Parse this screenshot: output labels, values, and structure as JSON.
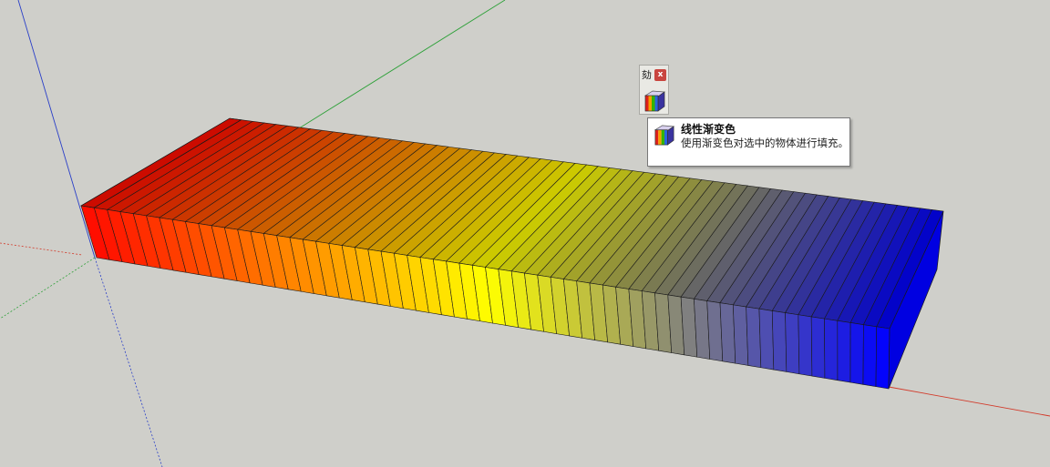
{
  "toolbar": {
    "title_glyph": "劾",
    "close_label": "x",
    "tool_icon": "gradient-cube-icon"
  },
  "tooltip": {
    "title": "线性渐变色",
    "description": "使用渐变色对选中的物体进行填充。",
    "icon": "gradient-cube-icon"
  },
  "model": {
    "slices": 62,
    "gradient_stops": [
      "#ff0a00",
      "#ffff00",
      "#0000ff"
    ]
  },
  "colors": {
    "background": "#cfcfca",
    "axis_red": "#d23a2a",
    "axis_green": "#2fa13a",
    "axis_blue": "#2a3fc8"
  }
}
